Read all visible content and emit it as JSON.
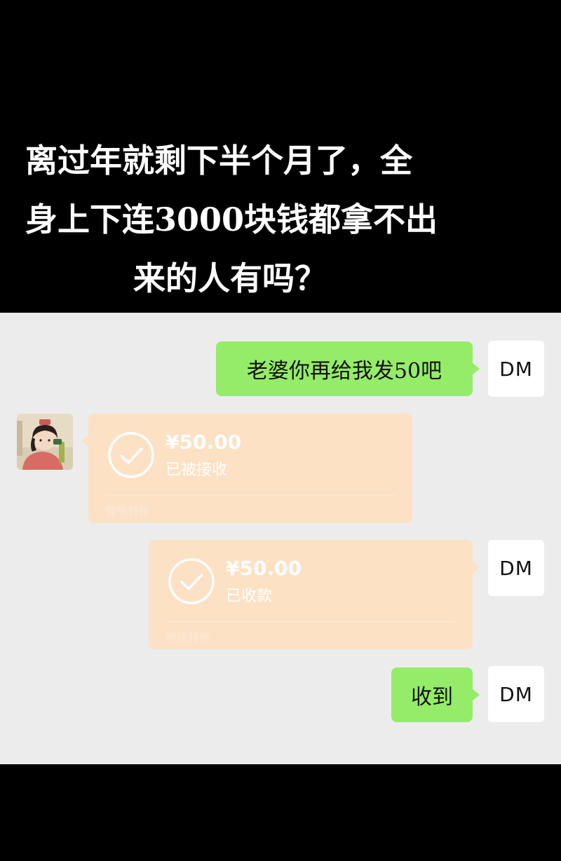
{
  "caption": {
    "line1": "离过年就剩下半个月了，全",
    "line2": "身上下连3000块钱都拿不出",
    "line3": "来的人有吗？"
  },
  "messages": {
    "m1": {
      "text": "老婆你再给我发50吧",
      "avatar": "DM"
    },
    "m2": {
      "amount": "¥50.00",
      "status": "已被接收",
      "footer": "微信转账"
    },
    "m3": {
      "amount": "¥50.00",
      "status": "已收款",
      "footer": "微信转账",
      "avatar": "DM"
    },
    "m4": {
      "text": "收到",
      "avatar": "DM"
    }
  },
  "colors": {
    "sent_bubble": "#95ec69",
    "transfer_card": "#fde1c4",
    "chat_background": "#ececec"
  }
}
